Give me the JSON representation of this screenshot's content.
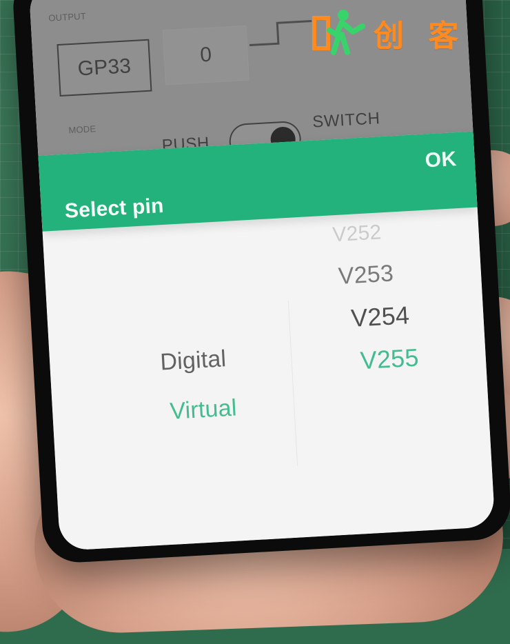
{
  "watermark": {
    "text": "创 客",
    "icon": "maker-figure-logo"
  },
  "app_under": {
    "output_label": "OUTPUT",
    "pin_label": "GP33",
    "value": "0",
    "mode_label": "MODE",
    "push_label": "PUSH",
    "switch_label": "SWITCH"
  },
  "dialog": {
    "title": "Select pin",
    "ok_label": "OK",
    "types": [
      "Digital",
      "Virtual"
    ],
    "pins": [
      "V252",
      "V253",
      "V254",
      "V255"
    ],
    "selected_type": "Virtual",
    "selected_pin": "V255",
    "colors": {
      "accent": "#23b27c",
      "header_text": "#ffffff"
    }
  }
}
